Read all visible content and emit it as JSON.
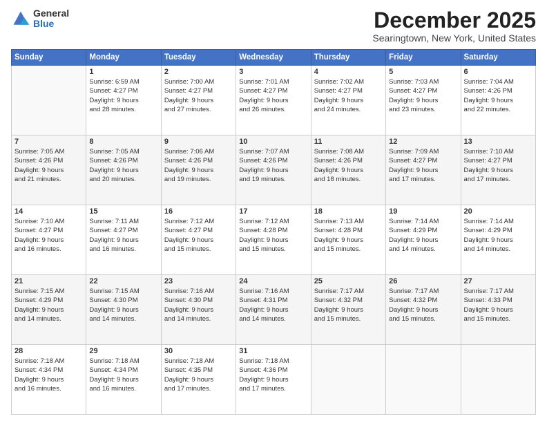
{
  "header": {
    "logo_general": "General",
    "logo_blue": "Blue",
    "month_title": "December 2025",
    "subtitle": "Searingtown, New York, United States"
  },
  "days_of_week": [
    "Sunday",
    "Monday",
    "Tuesday",
    "Wednesday",
    "Thursday",
    "Friday",
    "Saturday"
  ],
  "weeks": [
    [
      {
        "day": "",
        "content": ""
      },
      {
        "day": "1",
        "content": "Sunrise: 6:59 AM\nSunset: 4:27 PM\nDaylight: 9 hours\nand 28 minutes."
      },
      {
        "day": "2",
        "content": "Sunrise: 7:00 AM\nSunset: 4:27 PM\nDaylight: 9 hours\nand 27 minutes."
      },
      {
        "day": "3",
        "content": "Sunrise: 7:01 AM\nSunset: 4:27 PM\nDaylight: 9 hours\nand 26 minutes."
      },
      {
        "day": "4",
        "content": "Sunrise: 7:02 AM\nSunset: 4:27 PM\nDaylight: 9 hours\nand 24 minutes."
      },
      {
        "day": "5",
        "content": "Sunrise: 7:03 AM\nSunset: 4:27 PM\nDaylight: 9 hours\nand 23 minutes."
      },
      {
        "day": "6",
        "content": "Sunrise: 7:04 AM\nSunset: 4:26 PM\nDaylight: 9 hours\nand 22 minutes."
      }
    ],
    [
      {
        "day": "7",
        "content": "Sunrise: 7:05 AM\nSunset: 4:26 PM\nDaylight: 9 hours\nand 21 minutes."
      },
      {
        "day": "8",
        "content": "Sunrise: 7:05 AM\nSunset: 4:26 PM\nDaylight: 9 hours\nand 20 minutes."
      },
      {
        "day": "9",
        "content": "Sunrise: 7:06 AM\nSunset: 4:26 PM\nDaylight: 9 hours\nand 19 minutes."
      },
      {
        "day": "10",
        "content": "Sunrise: 7:07 AM\nSunset: 4:26 PM\nDaylight: 9 hours\nand 19 minutes."
      },
      {
        "day": "11",
        "content": "Sunrise: 7:08 AM\nSunset: 4:26 PM\nDaylight: 9 hours\nand 18 minutes."
      },
      {
        "day": "12",
        "content": "Sunrise: 7:09 AM\nSunset: 4:27 PM\nDaylight: 9 hours\nand 17 minutes."
      },
      {
        "day": "13",
        "content": "Sunrise: 7:10 AM\nSunset: 4:27 PM\nDaylight: 9 hours\nand 17 minutes."
      }
    ],
    [
      {
        "day": "14",
        "content": "Sunrise: 7:10 AM\nSunset: 4:27 PM\nDaylight: 9 hours\nand 16 minutes."
      },
      {
        "day": "15",
        "content": "Sunrise: 7:11 AM\nSunset: 4:27 PM\nDaylight: 9 hours\nand 16 minutes."
      },
      {
        "day": "16",
        "content": "Sunrise: 7:12 AM\nSunset: 4:27 PM\nDaylight: 9 hours\nand 15 minutes."
      },
      {
        "day": "17",
        "content": "Sunrise: 7:12 AM\nSunset: 4:28 PM\nDaylight: 9 hours\nand 15 minutes."
      },
      {
        "day": "18",
        "content": "Sunrise: 7:13 AM\nSunset: 4:28 PM\nDaylight: 9 hours\nand 15 minutes."
      },
      {
        "day": "19",
        "content": "Sunrise: 7:14 AM\nSunset: 4:29 PM\nDaylight: 9 hours\nand 14 minutes."
      },
      {
        "day": "20",
        "content": "Sunrise: 7:14 AM\nSunset: 4:29 PM\nDaylight: 9 hours\nand 14 minutes."
      }
    ],
    [
      {
        "day": "21",
        "content": "Sunrise: 7:15 AM\nSunset: 4:29 PM\nDaylight: 9 hours\nand 14 minutes."
      },
      {
        "day": "22",
        "content": "Sunrise: 7:15 AM\nSunset: 4:30 PM\nDaylight: 9 hours\nand 14 minutes."
      },
      {
        "day": "23",
        "content": "Sunrise: 7:16 AM\nSunset: 4:30 PM\nDaylight: 9 hours\nand 14 minutes."
      },
      {
        "day": "24",
        "content": "Sunrise: 7:16 AM\nSunset: 4:31 PM\nDaylight: 9 hours\nand 14 minutes."
      },
      {
        "day": "25",
        "content": "Sunrise: 7:17 AM\nSunset: 4:32 PM\nDaylight: 9 hours\nand 15 minutes."
      },
      {
        "day": "26",
        "content": "Sunrise: 7:17 AM\nSunset: 4:32 PM\nDaylight: 9 hours\nand 15 minutes."
      },
      {
        "day": "27",
        "content": "Sunrise: 7:17 AM\nSunset: 4:33 PM\nDaylight: 9 hours\nand 15 minutes."
      }
    ],
    [
      {
        "day": "28",
        "content": "Sunrise: 7:18 AM\nSunset: 4:34 PM\nDaylight: 9 hours\nand 16 minutes."
      },
      {
        "day": "29",
        "content": "Sunrise: 7:18 AM\nSunset: 4:34 PM\nDaylight: 9 hours\nand 16 minutes."
      },
      {
        "day": "30",
        "content": "Sunrise: 7:18 AM\nSunset: 4:35 PM\nDaylight: 9 hours\nand 17 minutes."
      },
      {
        "day": "31",
        "content": "Sunrise: 7:18 AM\nSunset: 4:36 PM\nDaylight: 9 hours\nand 17 minutes."
      },
      {
        "day": "",
        "content": ""
      },
      {
        "day": "",
        "content": ""
      },
      {
        "day": "",
        "content": ""
      }
    ]
  ]
}
